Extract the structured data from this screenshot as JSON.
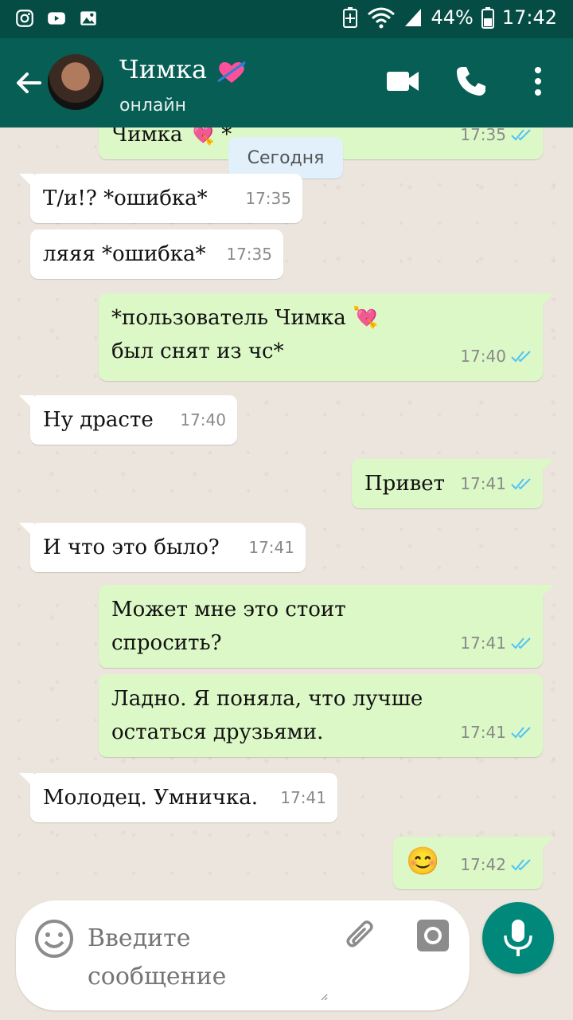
{
  "status_bar": {
    "battery": "44%",
    "time": "17:42"
  },
  "header": {
    "title": "Чимка",
    "subtitle": "онлайн"
  },
  "chat": {
    "date_label": "Сегодня",
    "messages": [
      {
        "text": "Чимка 💘 *",
        "time": "17:35"
      },
      {
        "text": "Т/и!? *ошибка*",
        "time": "17:35"
      },
      {
        "text": "ляяя *ошибка*",
        "time": "17:35"
      },
      {
        "text": "*пользователь Чимка 💘 был снят из чс*",
        "time": "17:40"
      },
      {
        "text": "Ну драсте",
        "time": "17:40"
      },
      {
        "text": "Привет",
        "time": "17:41"
      },
      {
        "text": "И что это было?",
        "time": "17:41"
      },
      {
        "text": "Может мне это стоит спросить?",
        "time": "17:41"
      },
      {
        "text": "Ладно. Я поняла, что лучше остаться друзьями.",
        "time": "17:41"
      },
      {
        "text": "Молодец. Умничка.",
        "time": "17:41"
      },
      {
        "text": "😊",
        "time": "17:42"
      }
    ]
  },
  "composer": {
    "placeholder": "Введите сообщение"
  },
  "colors": {
    "header": "#075e54",
    "status_bar": "#054d44",
    "outgoing": "#dcf8c6",
    "incoming": "#ffffff",
    "mic": "#00897b",
    "read_ticks": "#4fc3f7"
  }
}
